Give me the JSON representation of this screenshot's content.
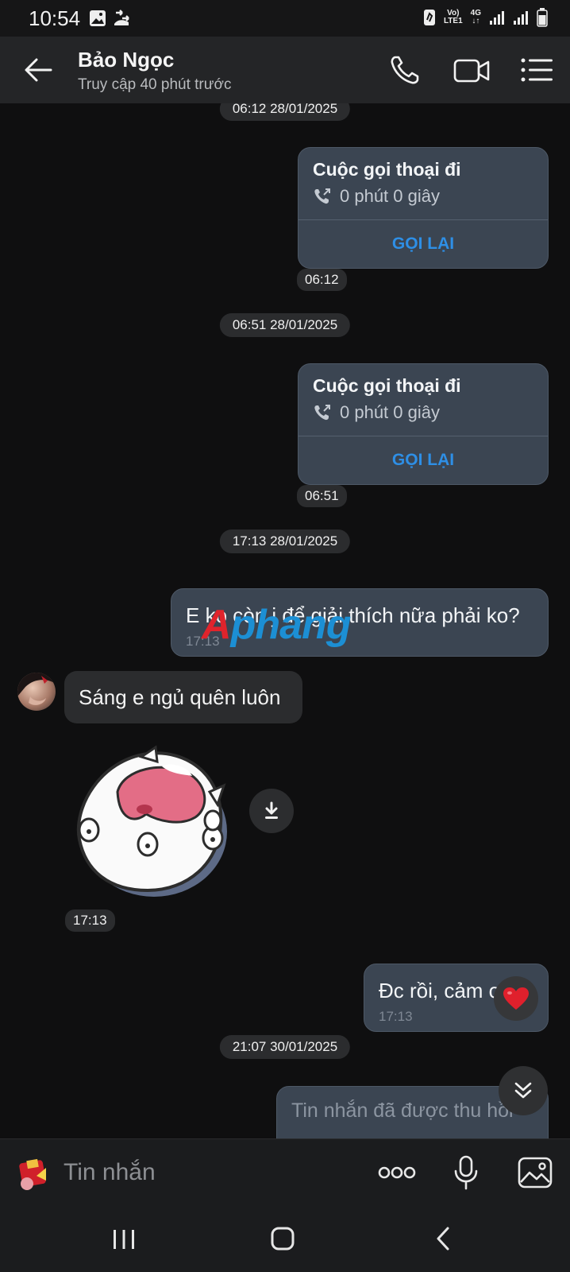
{
  "status_bar": {
    "time": "10:54",
    "network_top": "Vo)",
    "network_bottom": "LTE1",
    "data_type": "4G"
  },
  "header": {
    "contact_name": "Bảo Ngọc",
    "contact_status": "Truy cập 40 phút trước"
  },
  "chat": {
    "messages": [
      {
        "kind": "call",
        "date_stamp": "06:12 28/01/2025",
        "title": "Cuộc gọi thoại đi",
        "duration": "0 phút 0 giây",
        "action": "GỌI LẠI",
        "time": "06:12"
      },
      {
        "kind": "call",
        "date_stamp": "06:51 28/01/2025",
        "title": "Cuộc gọi thoại đi",
        "duration": "0 phút 0 giây",
        "action": "GỌI LẠI",
        "time": "06:51"
      },
      {
        "kind": "text_out",
        "date_stamp": "17:13 28/01/2025",
        "text": "E ko còn j để giải thích nữa phải ko?",
        "time": "17:13"
      },
      {
        "kind": "text_in",
        "text": "Sáng e ngủ quên luôn"
      },
      {
        "kind": "sticker_in",
        "time": "17:13"
      },
      {
        "kind": "text_out",
        "text": "Đc rồi, cảm ơn e",
        "time": "17:13",
        "reaction": "heart"
      },
      {
        "kind": "recalled_out",
        "date_stamp": "21:07 30/01/2025",
        "text": "Tin nhắn đã được thu hồi"
      }
    ],
    "watermark": {
      "first": "A",
      "rest": "phang"
    }
  },
  "input_bar": {
    "placeholder": "Tin nhắn"
  },
  "colors": {
    "outgoing_bubble": "#3b4552",
    "incoming_bubble": "#2b2c2e",
    "call_back_link": "#2e8fe6",
    "background": "#0f0f10"
  }
}
